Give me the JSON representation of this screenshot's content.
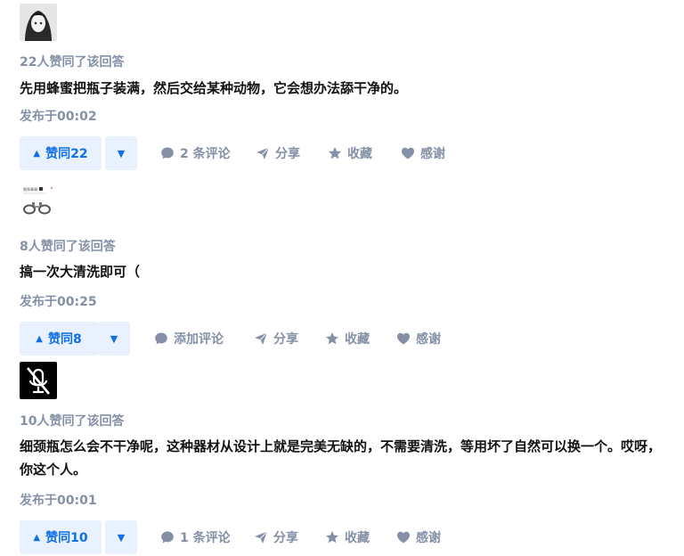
{
  "answers": [
    {
      "votes_text": "22人赞同了该回答",
      "content": "先用蜂蜜把瓶子装满，然后交给某种动物，它会想办法舔干净的。",
      "time": "发布于00:02",
      "upvote_label": "赞同22",
      "comment_label": "2 条评论",
      "share_label": "分享",
      "collect_label": "收藏",
      "thanks_label": "感谢"
    },
    {
      "votes_text": "8人赞同了该回答",
      "content": "搞一次大清洗即可（",
      "time": "发布于00:25",
      "upvote_label": "赞同8",
      "comment_label": "添加评论",
      "share_label": "分享",
      "collect_label": "收藏",
      "thanks_label": "感谢",
      "avatar_caption": "钢角事端"
    },
    {
      "votes_text": "10人赞同了该回答",
      "content": "细颈瓶怎么会不干净呢，这种器材从设计上就是完美无缺的，不需要清洗，等用坏了自然可以换一个。哎呀，你这个人。",
      "time": "发布于00:01",
      "upvote_label": "赞同10",
      "comment_label": "1 条评论",
      "share_label": "分享",
      "collect_label": "收藏",
      "thanks_label": "感谢"
    }
  ],
  "icons": {
    "upvote": "triangle-up-icon",
    "downvote": "triangle-down-icon",
    "comment": "speech-bubble-icon",
    "share": "paper-plane-icon",
    "collect": "star-icon",
    "thanks": "heart-icon"
  },
  "colors": {
    "accent": "#0f6fe6",
    "accent_bg": "#e8f1fd",
    "meta": "#8590a6",
    "text": "#121212"
  }
}
